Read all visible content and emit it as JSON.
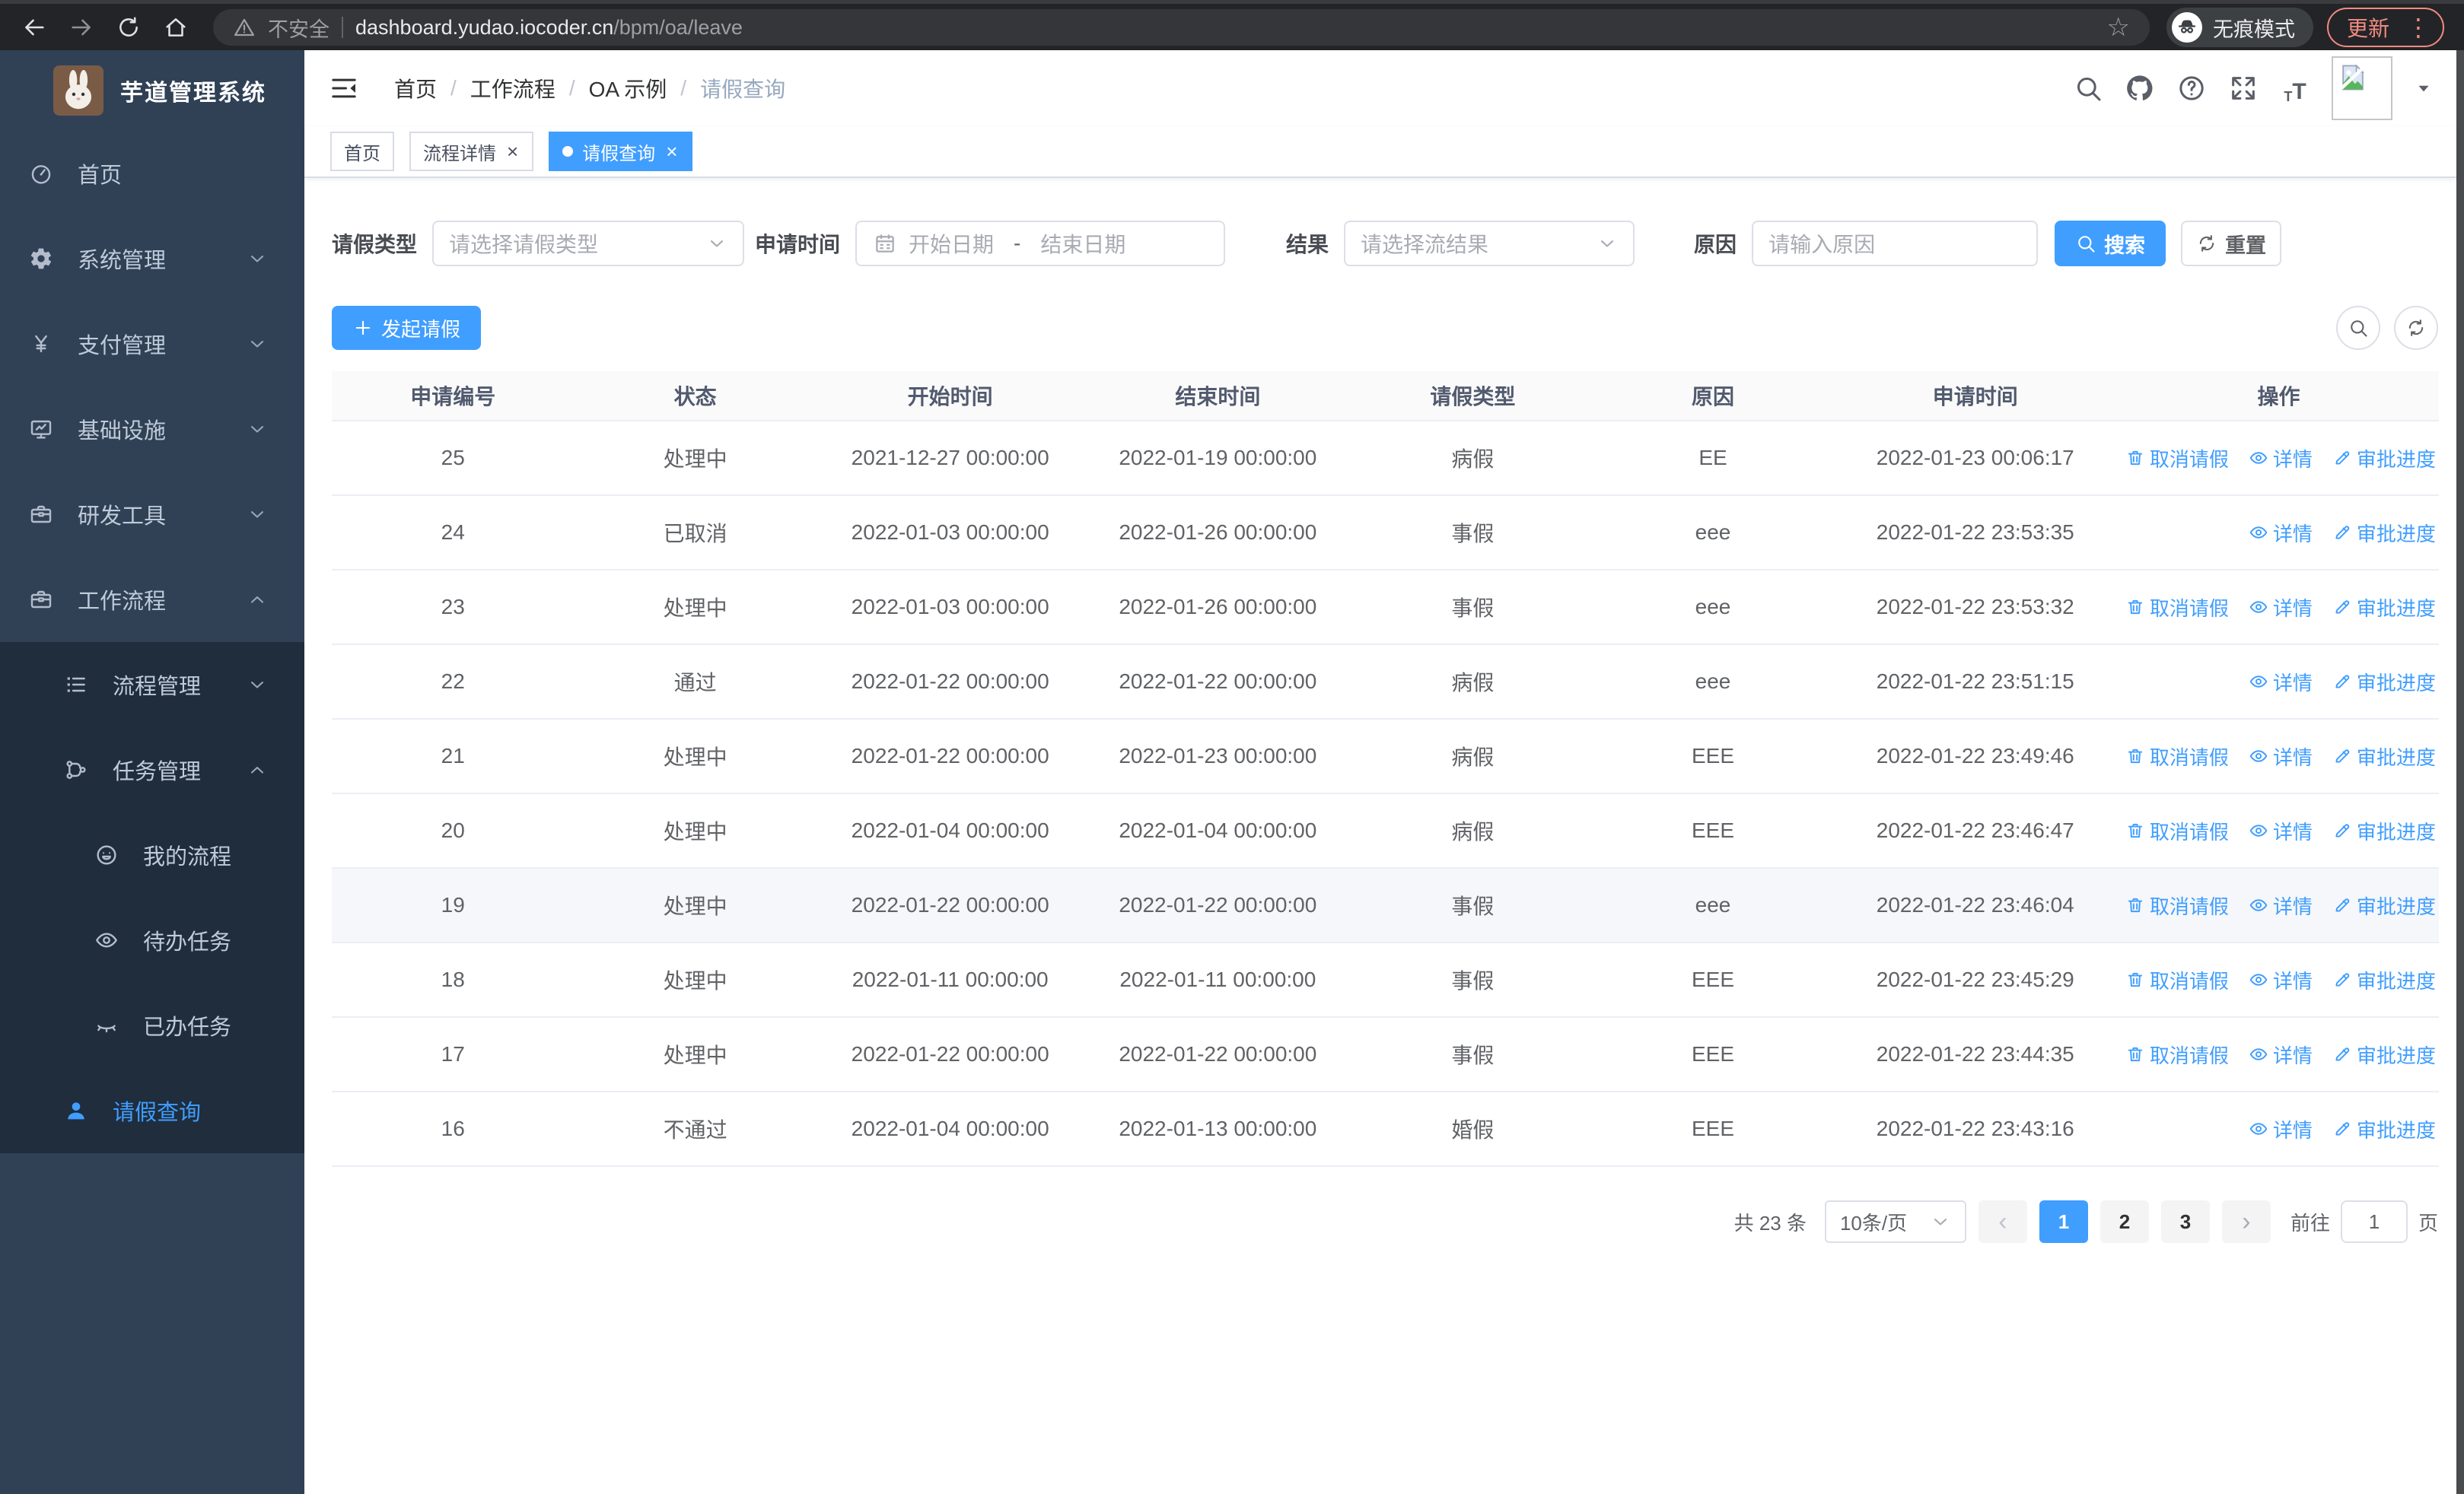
{
  "colors": {
    "primary": "#409eff",
    "sidebar_bg": "#304156",
    "submenu_bg": "#1f2d3d",
    "update_accent": "#f28b82"
  },
  "browser": {
    "not_secure": "不安全",
    "url_host": "dashboard.yudao.iocoder.cn",
    "url_path": "/bpm/oa/leave",
    "incognito_label": "无痕模式",
    "update_label": "更新"
  },
  "sidebar": {
    "title": "芋道管理系统",
    "items": [
      {
        "label": "首页",
        "icon": "gauge",
        "level": 0
      },
      {
        "label": "系统管理",
        "icon": "gear",
        "level": 0,
        "chevron": "chevron-down"
      },
      {
        "label": "支付管理",
        "icon": "yen",
        "level": 0,
        "chevron": "chevron-down"
      },
      {
        "label": "基础设施",
        "icon": "monitor",
        "level": 0,
        "chevron": "chevron-down"
      },
      {
        "label": "研发工具",
        "icon": "toolbox",
        "level": 0,
        "chevron": "chevron-down"
      },
      {
        "label": "工作流程",
        "icon": "briefcase",
        "level": 0,
        "chevron": "chevron-up"
      },
      {
        "label": "流程管理",
        "icon": "list-tree",
        "level": 1,
        "sub": true,
        "chevron": "chevron-down"
      },
      {
        "label": "任务管理",
        "icon": "share-nodes",
        "level": 1,
        "sub": true,
        "chevron": "chevron-up"
      },
      {
        "label": "我的流程",
        "icon": "face",
        "level": 2,
        "sub": true
      },
      {
        "label": "待办任务",
        "icon": "eye",
        "level": 2,
        "sub": true
      },
      {
        "label": "已办任务",
        "icon": "eye-closed",
        "level": 2,
        "sub": true
      },
      {
        "label": "请假查询",
        "icon": "user",
        "level": 1,
        "sub": true,
        "active": true
      }
    ]
  },
  "header": {
    "breadcrumb": [
      "首页",
      "工作流程",
      "OA 示例",
      "请假查询"
    ],
    "icons": [
      "search",
      "github",
      "question",
      "fullscreen",
      "font-size",
      "avatar",
      "caret-down"
    ]
  },
  "tabs": [
    {
      "label": "首页"
    },
    {
      "label": "流程详情",
      "closable": true
    },
    {
      "label": "请假查询",
      "closable": true,
      "active": true
    }
  ],
  "filters": {
    "type_label": "请假类型",
    "type_placeholder": "请选择请假类型",
    "time_label": "申请时间",
    "start_placeholder": "开始日期",
    "range_separator": "-",
    "end_placeholder": "结束日期",
    "result_label": "结果",
    "result_placeholder": "请选择流结果",
    "reason_label": "原因",
    "reason_placeholder": "请输入原因",
    "search_label": "搜索",
    "reset_label": "重置"
  },
  "toolbar": {
    "create_label": "发起请假"
  },
  "table": {
    "columns": [
      "申请编号",
      "状态",
      "开始时间",
      "结束时间",
      "请假类型",
      "原因",
      "申请时间",
      "操作"
    ],
    "action_labels": {
      "cancel": "取消请假",
      "detail": "详情",
      "progress": "审批进度"
    },
    "rows": [
      {
        "id": "25",
        "status": "处理中",
        "start": "2021-12-27 00:00:00",
        "end": "2022-01-19 00:00:00",
        "type": "病假",
        "reason": "EE",
        "applied": "2022-01-23 00:06:17",
        "can_cancel": true
      },
      {
        "id": "24",
        "status": "已取消",
        "start": "2022-01-03 00:00:00",
        "end": "2022-01-26 00:00:00",
        "type": "事假",
        "reason": "eee",
        "applied": "2022-01-22 23:53:35"
      },
      {
        "id": "23",
        "status": "处理中",
        "start": "2022-01-03 00:00:00",
        "end": "2022-01-26 00:00:00",
        "type": "事假",
        "reason": "eee",
        "applied": "2022-01-22 23:53:32",
        "can_cancel": true
      },
      {
        "id": "22",
        "status": "通过",
        "start": "2022-01-22 00:00:00",
        "end": "2022-01-22 00:00:00",
        "type": "病假",
        "reason": "eee",
        "applied": "2022-01-22 23:51:15"
      },
      {
        "id": "21",
        "status": "处理中",
        "start": "2022-01-22 00:00:00",
        "end": "2022-01-23 00:00:00",
        "type": "病假",
        "reason": "EEE",
        "applied": "2022-01-22 23:49:46",
        "can_cancel": true
      },
      {
        "id": "20",
        "status": "处理中",
        "start": "2022-01-04 00:00:00",
        "end": "2022-01-04 00:00:00",
        "type": "病假",
        "reason": "EEE",
        "applied": "2022-01-22 23:46:47",
        "can_cancel": true
      },
      {
        "id": "19",
        "status": "处理中",
        "start": "2022-01-22 00:00:00",
        "end": "2022-01-22 00:00:00",
        "type": "事假",
        "reason": "eee",
        "applied": "2022-01-22 23:46:04",
        "can_cancel": true,
        "hover": true
      },
      {
        "id": "18",
        "status": "处理中",
        "start": "2022-01-11 00:00:00",
        "end": "2022-01-11 00:00:00",
        "type": "事假",
        "reason": "EEE",
        "applied": "2022-01-22 23:45:29",
        "can_cancel": true
      },
      {
        "id": "17",
        "status": "处理中",
        "start": "2022-01-22 00:00:00",
        "end": "2022-01-22 00:00:00",
        "type": "事假",
        "reason": "EEE",
        "applied": "2022-01-22 23:44:35",
        "can_cancel": true
      },
      {
        "id": "16",
        "status": "不通过",
        "start": "2022-01-04 00:00:00",
        "end": "2022-01-13 00:00:00",
        "type": "婚假",
        "reason": "EEE",
        "applied": "2022-01-22 23:43:16"
      }
    ]
  },
  "pagination": {
    "total_label": "共 23 条",
    "page_size_label": "10条/页",
    "pages": [
      {
        "label": "1",
        "active": true
      },
      {
        "label": "2"
      },
      {
        "label": "3"
      }
    ],
    "prev_icon": "‹",
    "next_icon": "›",
    "goto_label": "前往",
    "goto_value": "1",
    "goto_unit": "页"
  }
}
